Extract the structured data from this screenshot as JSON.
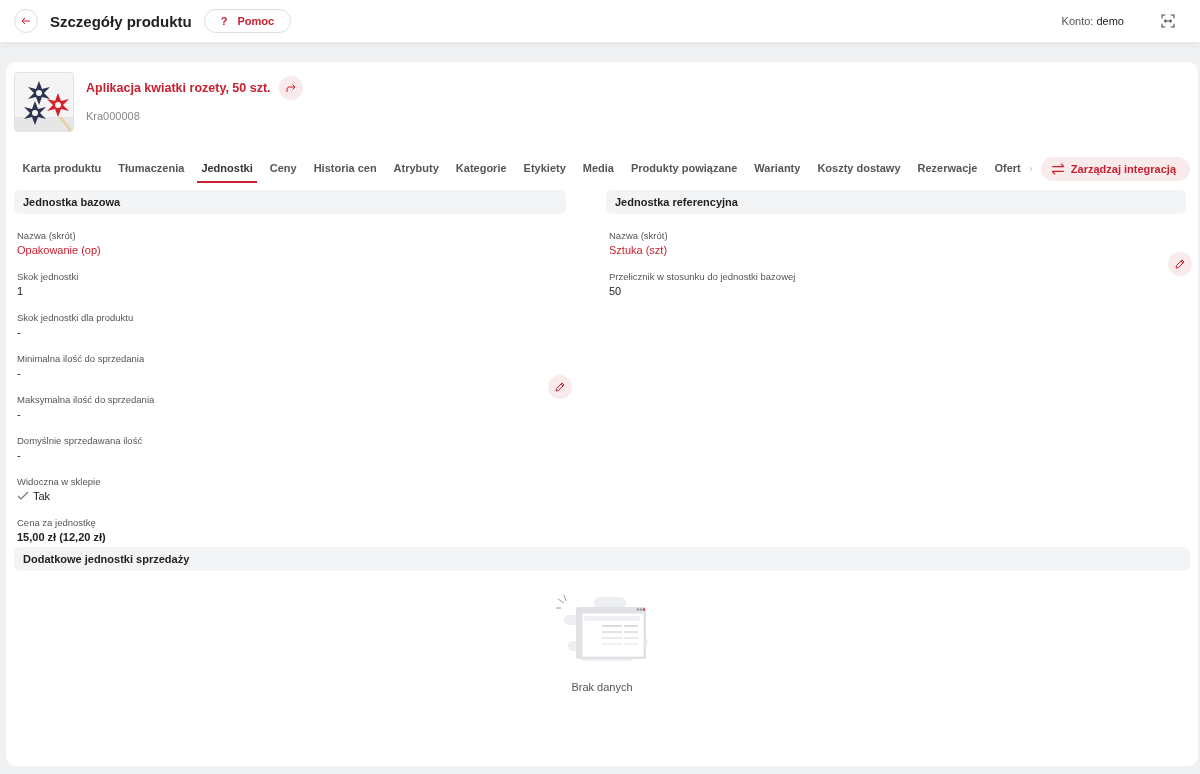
{
  "header": {
    "title": "Szczegóły produktu",
    "help": {
      "icon": "?",
      "label": "Pomoc"
    },
    "account_label": "Konto:",
    "account": "demo"
  },
  "product": {
    "name": "Aplikacja kwiatki rozety, 50 szt.",
    "code": "Kra000008"
  },
  "tabs": [
    {
      "label": "Karta produktu",
      "selected": false
    },
    {
      "label": "Tłumaczenia",
      "selected": false
    },
    {
      "label": "Jednostki",
      "selected": true
    },
    {
      "label": "Ceny",
      "selected": false
    },
    {
      "label": "Historia cen",
      "selected": false
    },
    {
      "label": "Atrybuty",
      "selected": false
    },
    {
      "label": "Kategorie",
      "selected": false
    },
    {
      "label": "Etykiety",
      "selected": false
    },
    {
      "label": "Media",
      "selected": false
    },
    {
      "label": "Produkty powiązane",
      "selected": false
    },
    {
      "label": "Warianty",
      "selected": false
    },
    {
      "label": "Koszty dostawy",
      "selected": false
    },
    {
      "label": "Rezerwacje",
      "selected": false
    },
    {
      "label": "Ofert",
      "selected": false
    }
  ],
  "integration_button": "Zarządzaj integracją",
  "sections": [
    {
      "title": "Jednostka bazowa",
      "fields": [
        {
          "label": "Nazwa (skrót)",
          "value": "Opakowanie (op)",
          "kind": "link"
        },
        {
          "label": "Skok jednostki",
          "value": "1",
          "kind": "text"
        },
        {
          "label": "Skok jednostki dla produktu",
          "value": "-",
          "kind": "text"
        },
        {
          "label": "Minimalna ilość do sprzedania",
          "value": "-",
          "kind": "text"
        },
        {
          "label": "Maksymalna ilość do sprzedania",
          "value": "-",
          "kind": "text"
        },
        {
          "label": "Domyślnie sprzedawana ilość",
          "value": "-",
          "kind": "text"
        },
        {
          "label": "Widoczna w sklepie",
          "value": "Tak",
          "kind": "check"
        },
        {
          "label": "Cena za jednostkę",
          "value": "15,00 zł (12,20 zł)",
          "kind": "bold"
        }
      ]
    },
    {
      "title": "Jednostka referencyjna",
      "fields": [
        {
          "label": "Nazwa (skrót)",
          "value": "Sztuka (szt)",
          "kind": "link"
        },
        {
          "label": "Przelicznik w stosunku do jednostki bazowej",
          "value": "50",
          "kind": "text"
        }
      ]
    }
  ],
  "extra_units": {
    "title": "Dodatkowe jednostki sprzedaży",
    "empty_text": "Brak danych"
  }
}
